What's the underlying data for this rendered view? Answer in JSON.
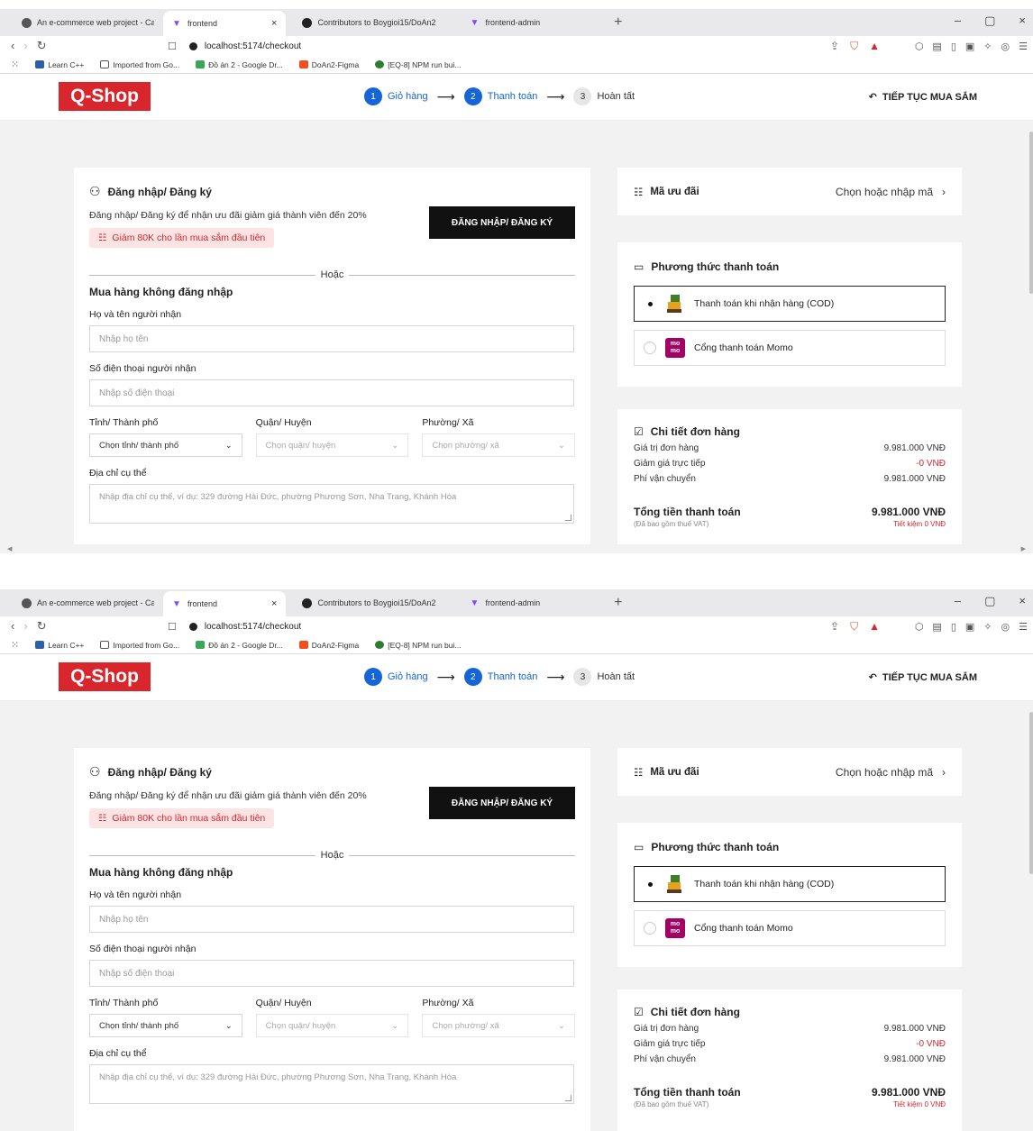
{
  "browser": {
    "tabs": [
      {
        "label": "An e-commerce web project - Cart li"
      },
      {
        "label": "frontend"
      },
      {
        "label": "Contributors to Boygioi15/DoAn2"
      },
      {
        "label": "frontend-admin"
      }
    ],
    "tab_close": "×",
    "new_tab": "+",
    "url": "localhost:5174/checkout",
    "bookmarks": [
      {
        "label": "Learn C++"
      },
      {
        "label": "Imported from Go..."
      },
      {
        "label": "Đồ án 2 - Google Dr..."
      },
      {
        "label": "DoAn2-Figma"
      },
      {
        "label": "[EQ-8] NPM run bui..."
      }
    ]
  },
  "header": {
    "logo": "Q-Shop",
    "steps": [
      {
        "num": "1",
        "label": "Giỏ hàng"
      },
      {
        "num": "2",
        "label": "Thanh toán"
      },
      {
        "num": "3",
        "label": "Hoàn tất"
      }
    ],
    "continue_shopping": "TIẾP TỤC MUA SẮM"
  },
  "login": {
    "title": "Đăng nhập/ Đăng ký",
    "description": "Đăng nhập/ Đăng ký để nhận ưu đãi giảm giá thành viên đến 20%",
    "button": "ĐĂNG NHẬP/ ĐĂNG KÝ",
    "promo": "Giảm 80K cho lần mua sắm đầu tiên",
    "or": "Hoặc"
  },
  "guest": {
    "title": "Mua hàng không đăng nhập",
    "name_label": "Họ và tên người nhận",
    "name_placeholder": "Nhập họ tên",
    "phone_label": "Số điện thoại người nhận",
    "phone_placeholder": "Nhập số điện thoại",
    "province_label": "Tỉnh/ Thành phố",
    "province_placeholder": "Chọn tỉnh/ thành phố",
    "district_label": "Quận/ Huyện",
    "district_placeholder": "Chọn quận/ huyện",
    "ward_label": "Phường/ Xã",
    "ward_placeholder": "Chọn phường/ xã",
    "address_label": "Địa chỉ cụ thể",
    "address_placeholder": "Nhập địa chỉ cụ thể, ví dụ: 329 đường Hải Đức, phường Phương Sơn, Nha Trang, Khánh Hòa"
  },
  "promo_code": {
    "title": "Mã ưu đãi",
    "action": "Chọn hoặc nhập mã"
  },
  "payment": {
    "title": "Phương thức thanh toán",
    "options": [
      {
        "label": "Thanh toán khi nhận hàng (COD)",
        "selected": true
      },
      {
        "label": "Cổng thanh toán Momo",
        "selected": false
      }
    ],
    "momo_text": "mo mo"
  },
  "order": {
    "title": "Chi tiết đơn hàng",
    "rows": [
      {
        "label": "Giá trị đơn hàng",
        "value": "9.981.000 VNĐ"
      },
      {
        "label": "Giảm giá trực tiếp",
        "value": "-0 VNĐ"
      },
      {
        "label": "Phí vận chuyển",
        "value": "9.981.000 VNĐ"
      }
    ],
    "total_label": "Tổng tiền thanh toán",
    "total_value": "9.981.000 VNĐ",
    "vat_note": "(Đã bao gồm thuế VAT)",
    "saving_note": "Tiết kiệm 0 VNĐ"
  },
  "colors": {
    "brand_red": "#d9262c",
    "step_blue": "#1565d8",
    "momo": "#a50064"
  }
}
